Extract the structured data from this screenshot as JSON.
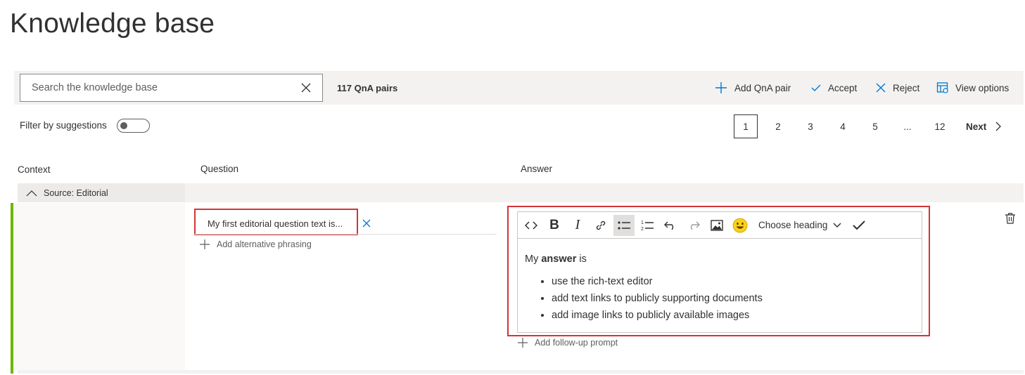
{
  "page": {
    "title": "Knowledge base"
  },
  "toolbar": {
    "search_placeholder": "Search the knowledge base",
    "qna_count": "117 QnA pairs",
    "add_label": "Add QnA pair",
    "accept_label": "Accept",
    "reject_label": "Reject",
    "view_options_label": "View options"
  },
  "filter": {
    "label": "Filter by suggestions",
    "enabled": false
  },
  "pager": {
    "pages": [
      "1",
      "2",
      "3",
      "4",
      "5",
      "...",
      "12"
    ],
    "current": "1",
    "next_label": "Next"
  },
  "columns": {
    "context": "Context",
    "question": "Question",
    "answer": "Answer"
  },
  "source": {
    "label": "Source: Editorial"
  },
  "item": {
    "question": "My first editorial question text is...",
    "alt_phrasing_label": "Add alternative phrasing",
    "followup_label": "Add follow-up prompt",
    "editor": {
      "heading_label": "Choose heading",
      "answer_prefix": "My ",
      "answer_bold": "answer",
      "answer_suffix": " is",
      "bullets": [
        "use the rich-text editor",
        "add text links to publicly supporting documents",
        "add image links to publicly available images"
      ]
    }
  },
  "colors": {
    "accent": "#0078d4",
    "highlight": "#d13438",
    "row_marker": "#6bb700"
  },
  "icons": [
    "clear-icon",
    "add-icon",
    "check-icon",
    "close-icon",
    "view-options-icon",
    "chevron-right-icon",
    "chevron-up-icon",
    "delete-icon",
    "code-icon",
    "bold-icon",
    "italic-icon",
    "link-icon",
    "bullet-list-icon",
    "numbered-list-icon",
    "undo-icon",
    "redo-icon",
    "image-icon",
    "emoji-icon",
    "chevron-down-icon",
    "trash-icon"
  ]
}
